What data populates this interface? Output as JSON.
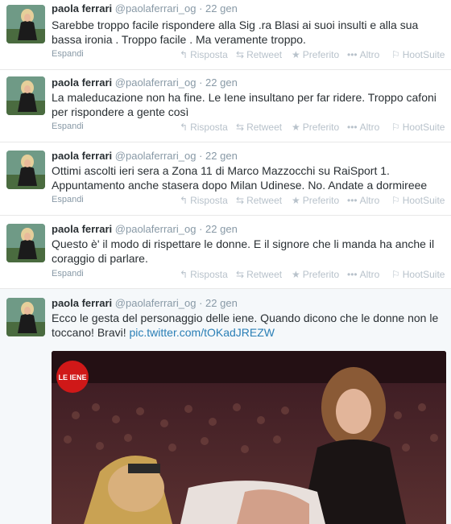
{
  "tweets": [
    {
      "name": "paola ferrari",
      "handle": "@paolaferrari_og",
      "separator": "·",
      "time": "22 gen",
      "text": "Sarebbe troppo facile rispondere alla Sig .ra Blasi ai suoi insulti e alla sua bassa ironia . Troppo facile . Ma veramente troppo.",
      "expand": "Espandi"
    },
    {
      "name": "paola ferrari",
      "handle": "@paolaferrari_og",
      "separator": "·",
      "time": "22 gen",
      "text": "La maleducazione non ha fine. Le Iene insultano per far ridere. Troppo cafoni per rispondere a gente così",
      "expand": "Espandi"
    },
    {
      "name": "paola ferrari",
      "handle": "@paolaferrari_og",
      "separator": "·",
      "time": "22 gen",
      "text": "Ottimi ascolti ieri sera a Zona 11 di Marco Mazzocchi  su RaiSport 1. Appuntamento anche stasera dopo Milan Udinese. No. Andate a dormireee",
      "expand": "Espandi"
    },
    {
      "name": "paola ferrari",
      "handle": "@paolaferrari_og",
      "separator": "·",
      "time": "22 gen",
      "text": "Questo è' il modo di rispettare le donne. E il signore che li manda ha anche il coraggio di parlare.",
      "expand": "Espandi"
    },
    {
      "name": "paola ferrari",
      "handle": "@paolaferrari_og",
      "separator": "·",
      "time": "22 gen",
      "text": "Ecco le gesta del personaggio delle iene. Quando dicono che le donne non le toccano! Bravi!",
      "link": "pic.twitter.com/tOKadJREZW"
    }
  ],
  "actions": {
    "reply": "Risposta",
    "retweet": "Retweet",
    "favorite": "Preferito",
    "more": "Altro",
    "hootsuite": "HootSuite"
  },
  "media": {
    "logo_text": "LE IENE"
  },
  "colors": {
    "name": "#292f33",
    "meta": "#8899a6",
    "action": "#b8c2cb",
    "link": "#2a7fb6",
    "expanded_bg": "#f5f8fa"
  }
}
